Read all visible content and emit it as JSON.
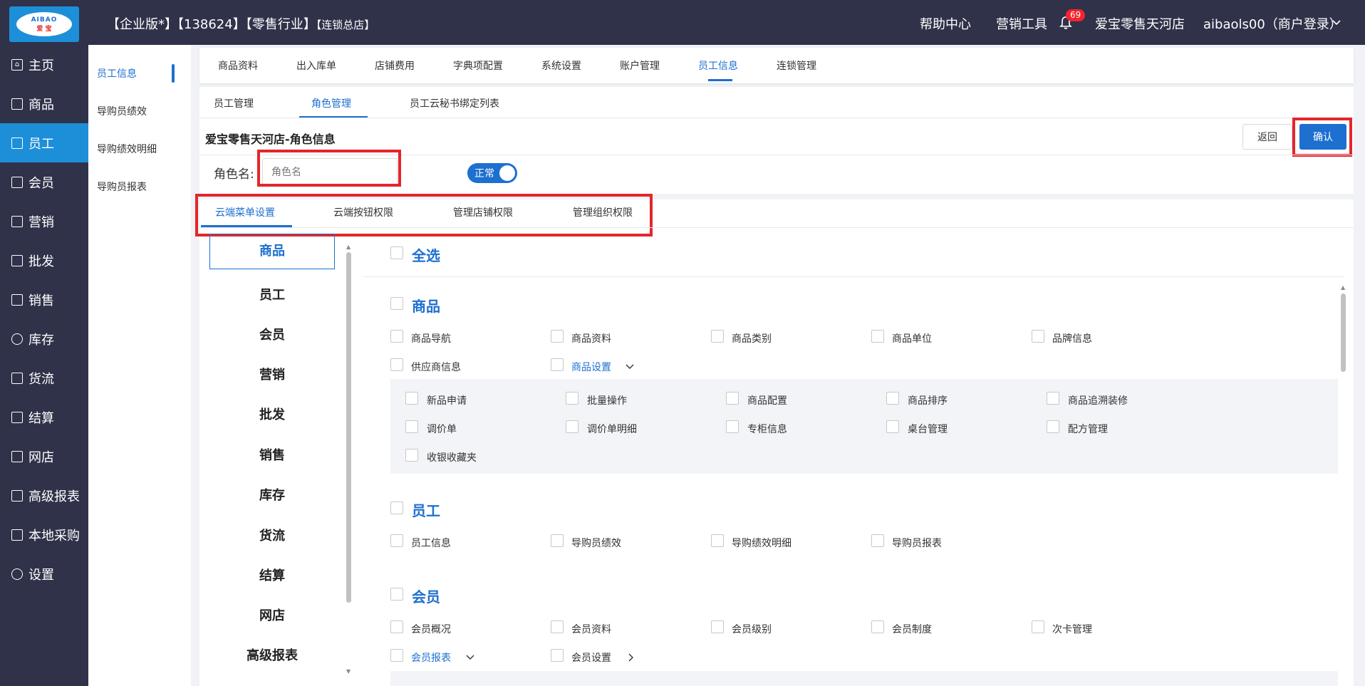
{
  "header": {
    "logo_line1": "AIBAO",
    "logo_line2": "爱 宝",
    "title_main": "【企业版*】【138624】【零售行业】",
    "title_small": "【连锁总店】",
    "help": "帮助中心",
    "marketing_tools": "营销工具",
    "notification_count": "69",
    "store_name": "爱宝零售天河店",
    "user": "aibaols00（商户登录）"
  },
  "leftnav": [
    {
      "label": "主页",
      "icon": "home-icon"
    },
    {
      "label": "商品",
      "icon": "goods-icon"
    },
    {
      "label": "员工",
      "icon": "staff-icon",
      "active": true
    },
    {
      "label": "会员",
      "icon": "member-icon"
    },
    {
      "label": "营销",
      "icon": "marketing-icon"
    },
    {
      "label": "批发",
      "icon": "wholesale-icon"
    },
    {
      "label": "销售",
      "icon": "sales-icon"
    },
    {
      "label": "库存",
      "icon": "inventory-icon"
    },
    {
      "label": "货流",
      "icon": "logistics-icon"
    },
    {
      "label": "结算",
      "icon": "settlement-icon"
    },
    {
      "label": "网店",
      "icon": "shop-icon"
    },
    {
      "label": "高级报表",
      "icon": "report-icon"
    },
    {
      "label": "本地采购",
      "icon": "purchase-icon"
    },
    {
      "label": "设置",
      "icon": "gear-icon"
    }
  ],
  "subnav": [
    {
      "label": "员工信息",
      "active": true
    },
    {
      "label": "导购员绩效"
    },
    {
      "label": "导购绩效明细"
    },
    {
      "label": "导购员报表"
    }
  ],
  "tabs": [
    "商品资料",
    "出入库单",
    "店铺费用",
    "字典项配置",
    "系统设置",
    "账户管理",
    "员工信息",
    "连锁管理"
  ],
  "active_tab": "员工信息",
  "subtabs": [
    "员工管理",
    "角色管理",
    "员工云秘书绑定列表"
  ],
  "active_subtab": "角色管理",
  "page_title": "爱宝零售天河店-角色信息",
  "buttons": {
    "back": "返回",
    "confirm": "确认"
  },
  "role_form": {
    "label": "角色名:",
    "placeholder": "角色名",
    "status": "正常"
  },
  "perm_tabs": [
    "云端菜单设置",
    "云端按钮权限",
    "管理店铺权限",
    "管理组织权限"
  ],
  "active_perm_tab": "云端菜单设置",
  "categories": [
    "商品",
    "员工",
    "会员",
    "营销",
    "批发",
    "销售",
    "库存",
    "货流",
    "结算",
    "网店",
    "高级报表"
  ],
  "active_category": "商品",
  "select_all": "全选",
  "groups": {
    "goods": {
      "title": "商品",
      "row1": [
        "商品导航",
        "商品资料",
        "商品类别",
        "商品单位",
        "品牌信息"
      ],
      "supplier": "供应商信息",
      "settings": "商品设置",
      "sub_row1": [
        "新品申请",
        "批量操作",
        "商品配置",
        "商品排序",
        "商品追溯装修"
      ],
      "sub_row2": [
        "调价单",
        "调价单明细",
        "专柜信息",
        "桌台管理",
        "配方管理"
      ],
      "sub_row3": [
        "收银收藏夹"
      ]
    },
    "staff": {
      "title": "员工",
      "items": [
        "员工信息",
        "导购员绩效",
        "导购绩效明细",
        "导购员报表"
      ]
    },
    "member": {
      "title": "会员",
      "items": [
        "会员概况",
        "会员资料",
        "会员级别",
        "会员制度",
        "次卡管理"
      ],
      "report": "会员报表",
      "settings": "会员设置"
    }
  }
}
